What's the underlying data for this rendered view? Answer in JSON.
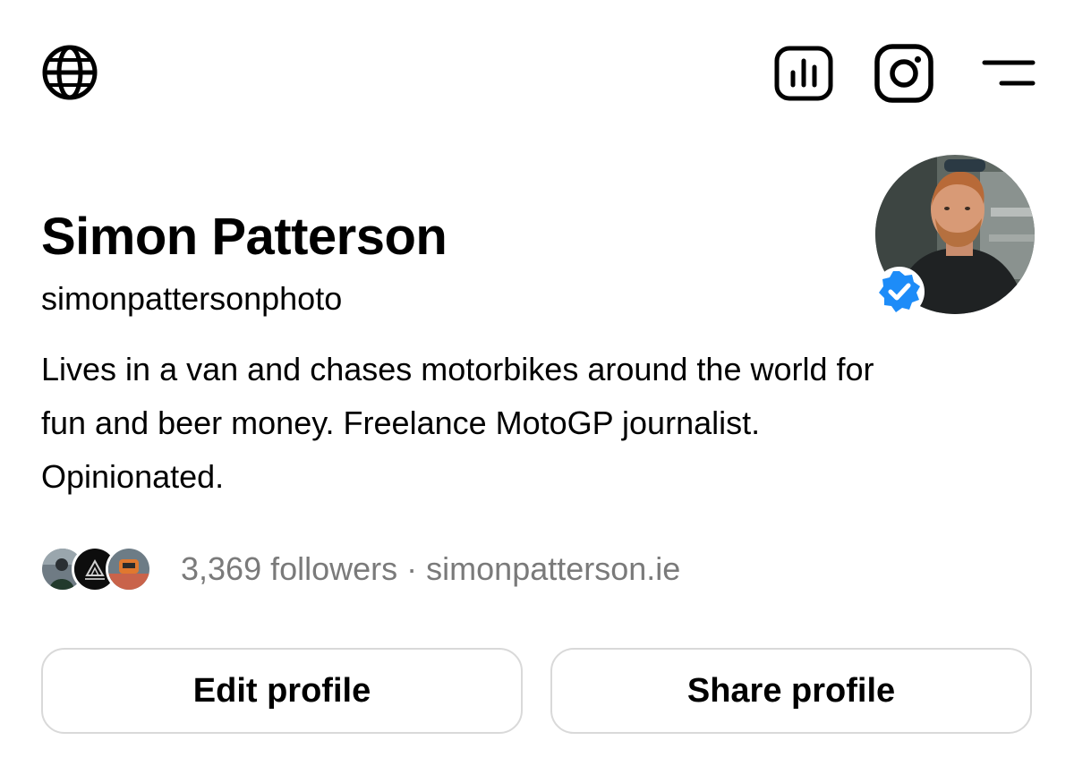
{
  "header": {
    "icons": [
      "globe-icon",
      "insights-icon",
      "instagram-icon",
      "menu-icon"
    ]
  },
  "profile": {
    "name": "Simon Patterson",
    "handle": "simonpattersonphoto",
    "bio_lines": [
      "Lives in a van and chases motorbikes around the world for",
      "fun and beer money. Freelance MotoGP journalist.",
      "Opinionated."
    ],
    "verified": true,
    "followers": "3,369 followers",
    "separator": "·",
    "website": "simonpatterson.ie"
  },
  "actions": {
    "edit_label": "Edit profile",
    "share_label": "Share profile"
  },
  "colors": {
    "text": "#000000",
    "muted": "#7a7a7a",
    "verified_blue": "#1d8cf8",
    "button_border": "#d9d9d9"
  }
}
